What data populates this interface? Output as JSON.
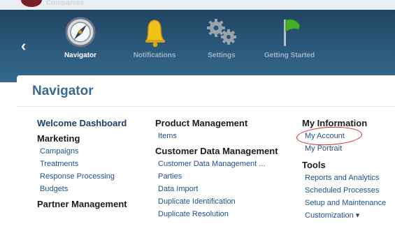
{
  "header": {
    "brand": "Companies",
    "nav": [
      {
        "label": "Navigator",
        "icon": "compass-icon"
      },
      {
        "label": "Notifications",
        "icon": "bell-icon"
      },
      {
        "label": "Settings",
        "icon": "gears-icon"
      },
      {
        "label": "Getting Started",
        "icon": "flag-icon"
      }
    ]
  },
  "panel": {
    "title": "Navigator",
    "col1": {
      "welcome": "Welcome Dashboard",
      "marketing": {
        "heading": "Marketing",
        "items": [
          "Campaigns",
          "Treatments",
          "Response Processing",
          "Budgets"
        ]
      },
      "partner": {
        "heading": "Partner Management"
      }
    },
    "col2": {
      "product": {
        "heading": "Product Management",
        "items": [
          "Items"
        ]
      },
      "customer": {
        "heading": "Customer Data Management",
        "items": [
          "Customer Data Management ...",
          "Parties",
          "Data Import",
          "Duplicate Identification",
          "Duplicate Resolution"
        ]
      }
    },
    "col3": {
      "myinfo": {
        "heading": "My Information",
        "items": [
          "My Account",
          "My Portrait"
        ]
      },
      "tools": {
        "heading": "Tools",
        "items": [
          "Reports and Analytics",
          "Scheduled Processes",
          "Setup and Maintenance",
          "Customization ▾"
        ]
      }
    }
  },
  "colors": {
    "header": "#2b5878",
    "title": "#3a6a94",
    "link": "#1f4f8a",
    "annotation": "#d4282b"
  }
}
